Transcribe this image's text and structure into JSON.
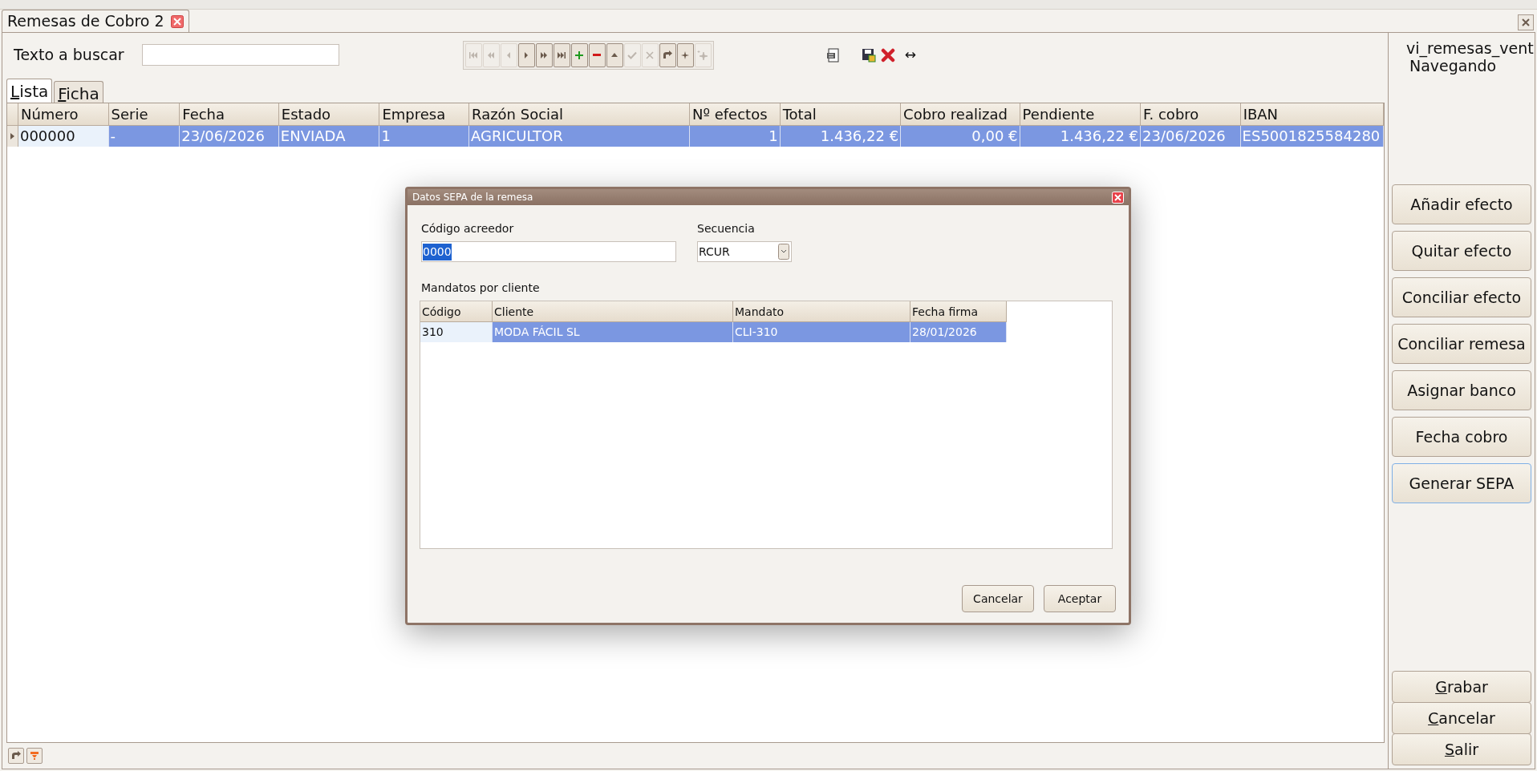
{
  "document_tab": {
    "title": "Remesas de Cobro 2"
  },
  "search": {
    "label": "Texto a buscar"
  },
  "nav_toolbar": [
    {
      "kind": "first",
      "disabled": true
    },
    {
      "kind": "prev-page",
      "disabled": true
    },
    {
      "kind": "prev",
      "disabled": true
    },
    {
      "kind": "next",
      "disabled": false
    },
    {
      "kind": "next-page",
      "disabled": false
    },
    {
      "kind": "last",
      "disabled": false
    },
    {
      "kind": "add",
      "disabled": false
    },
    {
      "kind": "remove",
      "disabled": false
    },
    {
      "kind": "up",
      "disabled": false
    },
    {
      "kind": "confirm",
      "disabled": true
    },
    {
      "kind": "cancel",
      "disabled": true
    },
    {
      "kind": "refresh",
      "disabled": false
    },
    {
      "kind": "star",
      "disabled": false
    },
    {
      "kind": "star-new",
      "disabled": true
    }
  ],
  "resize_glyph": "↔",
  "status": {
    "view": "vi_remesas_vent",
    "mode": "Navegando"
  },
  "view_tabs": [
    {
      "label": "Lista",
      "selected": true,
      "underline_first": true
    },
    {
      "label": "Ficha",
      "selected": false,
      "underline_first": true
    }
  ],
  "table": {
    "columns": [
      {
        "label": "Número",
        "numeric": false
      },
      {
        "label": "Serie",
        "numeric": false
      },
      {
        "label": "Fecha",
        "numeric": false
      },
      {
        "label": "Estado",
        "numeric": false
      },
      {
        "label": "Empresa",
        "numeric": false
      },
      {
        "label": "Razón Social",
        "numeric": false
      },
      {
        "label": "Nº efectos",
        "numeric": true
      },
      {
        "label": "Total",
        "numeric": true
      },
      {
        "label": "Cobro realizad",
        "numeric": true
      },
      {
        "label": "Pendiente",
        "numeric": true
      },
      {
        "label": "F. cobro",
        "numeric": false
      },
      {
        "label": "IBAN",
        "numeric": false
      }
    ],
    "rows": [
      {
        "selected": true,
        "cells": [
          "000000",
          "-",
          "23/06/2026",
          "ENVIADA",
          "1",
          "AGRICULTOR",
          "1",
          "1.436,22 €",
          "0,00 €",
          "1.436,22 €",
          "23/06/2026",
          "ES5001825584280"
        ]
      }
    ]
  },
  "side_buttons": [
    {
      "label": "Añadir efecto",
      "focused": false
    },
    {
      "label": "Quitar efecto",
      "focused": false
    },
    {
      "label": "Conciliar efecto",
      "focused": false
    },
    {
      "label": "Conciliar remesa",
      "focused": false
    },
    {
      "label": "Asignar banco",
      "focused": false
    },
    {
      "label": "Fecha cobro",
      "focused": false
    },
    {
      "label": "Generar SEPA",
      "focused": true
    }
  ],
  "bottom_buttons": [
    {
      "label": "Grabar",
      "underline_first": true
    },
    {
      "label": "Cancelar",
      "underline_first": true
    },
    {
      "label": "Salir",
      "underline_first": true
    }
  ],
  "dialog": {
    "title": "Datos SEPA de la remesa",
    "creditor": {
      "label": "Código acreedor",
      "value": "0000",
      "text_selected": true
    },
    "sequence": {
      "label": "Secuencia",
      "value": "RCUR"
    },
    "mandates_label": "Mandatos por cliente",
    "grid": {
      "columns": [
        "Código",
        "Cliente",
        "Mandato",
        "Fecha firma"
      ],
      "rows": [
        {
          "selected": true,
          "cells": [
            "310",
            "MODA FÁCIL SL",
            "CLI-310",
            "28/01/2026"
          ]
        }
      ]
    },
    "buttons": [
      "Cancelar",
      "Aceptar"
    ]
  }
}
